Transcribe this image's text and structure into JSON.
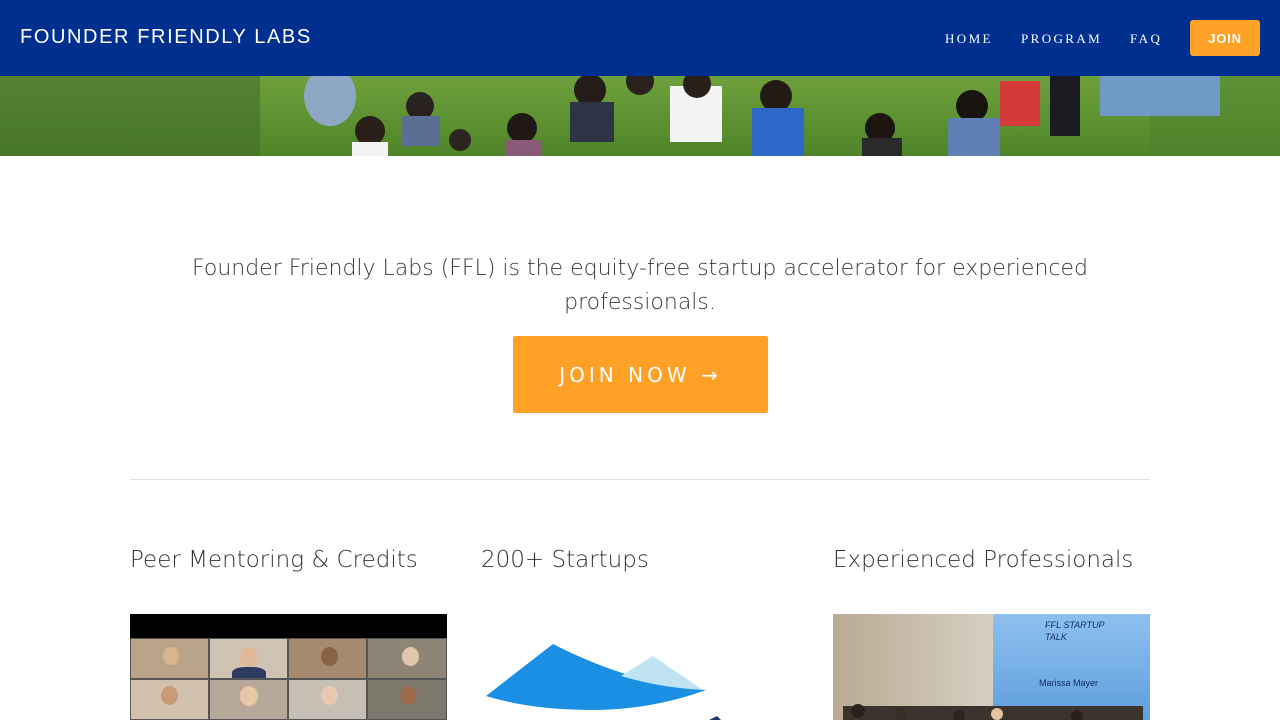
{
  "header": {
    "brand": "FOUNDER FRIENDLY LABS",
    "nav": {
      "home": "HOME",
      "program": "PROGRAM",
      "faq": "FAQ",
      "join": "JOIN"
    }
  },
  "hero": {
    "image": "group-photo-waving-aerial"
  },
  "intro": {
    "tagline": "Founder Friendly Labs (FFL) is the equity-free startup accelerator for experienced professionals.",
    "cta": "JOIN NOW →"
  },
  "features": [
    {
      "title": "Peer Mentoring & Credits",
      "image": "video-call-grid"
    },
    {
      "title": "200+ Startups",
      "image": "ffl-wave-logo"
    },
    {
      "title": "Experienced Professionals",
      "image": "startup-talk-room"
    }
  ],
  "talk_slide": {
    "line1": "FFL STARTUP",
    "line2": "TALK",
    "speaker": "Marissa Mayer"
  },
  "colors": {
    "header_bg": "#00308f",
    "accent": "#ffa027",
    "logo_blue": "#1a8fe3",
    "logo_light": "#bfe3f2"
  }
}
